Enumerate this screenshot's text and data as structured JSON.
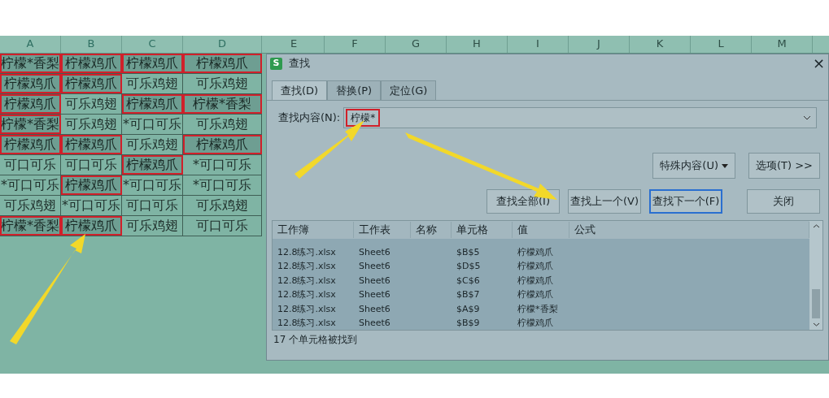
{
  "sheet": {
    "columns": [
      "A",
      "B",
      "C",
      "D"
    ],
    "more_columns": [
      "E",
      "F",
      "G",
      "H",
      "I",
      "J",
      "K",
      "L",
      "M"
    ],
    "rows": [
      [
        {
          "text": "柠檬*香梨",
          "matched": true
        },
        {
          "text": "柠檬鸡爪",
          "matched": true
        },
        {
          "text": "柠檬鸡爪",
          "matched": true
        },
        {
          "text": "柠檬鸡爪",
          "matched": true
        }
      ],
      [
        {
          "text": "柠檬鸡爪",
          "matched": true
        },
        {
          "text": "柠檬鸡爪",
          "matched": true
        },
        {
          "text": "可乐鸡翅",
          "matched": false
        },
        {
          "text": "可乐鸡翅",
          "matched": false
        }
      ],
      [
        {
          "text": "柠檬鸡爪",
          "matched": true
        },
        {
          "text": "可乐鸡翅",
          "matched": false
        },
        {
          "text": "柠檬鸡爪",
          "matched": true
        },
        {
          "text": "柠檬*香梨",
          "matched": true
        }
      ],
      [
        {
          "text": "柠檬*香梨",
          "matched": true
        },
        {
          "text": "可乐鸡翅",
          "matched": false
        },
        {
          "text": "*可口可乐",
          "matched": false
        },
        {
          "text": "可乐鸡翅",
          "matched": false
        }
      ],
      [
        {
          "text": "柠檬鸡爪",
          "matched": true
        },
        {
          "text": "柠檬鸡爪",
          "matched": true
        },
        {
          "text": "可乐鸡翅",
          "matched": false
        },
        {
          "text": "柠檬鸡爪",
          "matched": true
        }
      ],
      [
        {
          "text": "可口可乐",
          "matched": false
        },
        {
          "text": "可口可乐",
          "matched": false
        },
        {
          "text": "柠檬鸡爪",
          "matched": true
        },
        {
          "text": "*可口可乐",
          "matched": false
        }
      ],
      [
        {
          "text": "*可口可乐",
          "matched": false
        },
        {
          "text": "柠檬鸡爪",
          "matched": true
        },
        {
          "text": "*可口可乐",
          "matched": false
        },
        {
          "text": "*可口可乐",
          "matched": false
        }
      ],
      [
        {
          "text": "可乐鸡翅",
          "matched": false
        },
        {
          "text": "*可口可乐",
          "matched": false
        },
        {
          "text": "可口可乐",
          "matched": false
        },
        {
          "text": "可乐鸡翅",
          "matched": false
        }
      ],
      [
        {
          "text": "柠檬*香梨",
          "matched": true
        },
        {
          "text": "柠檬鸡爪",
          "matched": true
        },
        {
          "text": "可乐鸡翅",
          "matched": false
        },
        {
          "text": "可口可乐",
          "matched": false
        }
      ]
    ]
  },
  "dialog": {
    "app_icon": "S",
    "title": "查找",
    "close": "×",
    "tabs": [
      {
        "label": "查找(D)",
        "selected": true
      },
      {
        "label": "替换(P)",
        "selected": false
      },
      {
        "label": "定位(G)",
        "selected": false
      }
    ],
    "find_label": "查找内容(N):",
    "find_value": "柠檬*",
    "option_buttons": [
      {
        "label": "特殊内容(U)",
        "kind": "dropdown"
      },
      {
        "label": "选项(T) >>",
        "kind": "plain"
      }
    ],
    "buttons": [
      {
        "label": "查找全部(I)",
        "focused": false
      },
      {
        "label": "查找上一个(V)",
        "focused": false
      },
      {
        "label": "查找下一个(F)",
        "focused": true
      },
      {
        "label": "关闭",
        "focused": false
      }
    ],
    "results": {
      "columns": [
        "工作簿",
        "工作表",
        "名称",
        "单元格",
        "值",
        "公式"
      ],
      "rows": [
        [
          "12.8练习.xlsx",
          "Sheet6",
          "",
          "$B$5",
          "柠檬鸡爪",
          ""
        ],
        [
          "12.8练习.xlsx",
          "Sheet6",
          "",
          "$D$5",
          "柠檬鸡爪",
          ""
        ],
        [
          "12.8练习.xlsx",
          "Sheet6",
          "",
          "$C$6",
          "柠檬鸡爪",
          ""
        ],
        [
          "12.8练习.xlsx",
          "Sheet6",
          "",
          "$B$7",
          "柠檬鸡爪",
          ""
        ],
        [
          "12.8练习.xlsx",
          "Sheet6",
          "",
          "$A$9",
          "柠檬*香梨",
          ""
        ],
        [
          "12.8练习.xlsx",
          "Sheet6",
          "",
          "$B$9",
          "柠檬鸡爪",
          ""
        ]
      ]
    },
    "status": "17 个单元格被找到"
  }
}
